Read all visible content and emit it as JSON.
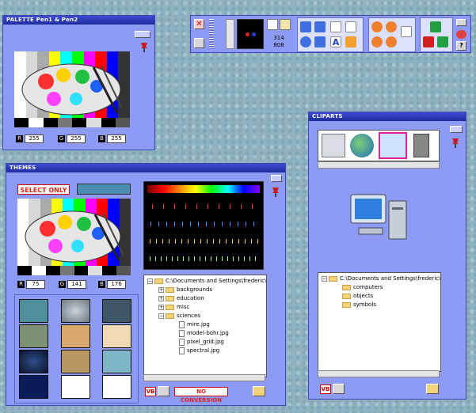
{
  "palette_window": {
    "title": "PALETTE Pen1 & Pen2",
    "rgb": [
      {
        "label": "R",
        "value": "255"
      },
      {
        "label": "G",
        "value": "255"
      },
      {
        "label": "B",
        "value": "255"
      }
    ]
  },
  "toolbar": {
    "counter_top": "314",
    "counter_bottom": "808"
  },
  "themes_window": {
    "title": "THEMES",
    "select_only_label": "SELECT ONLY",
    "rgb": [
      {
        "label": "R",
        "value": "75"
      },
      {
        "label": "G",
        "value": "141"
      },
      {
        "label": "B",
        "value": "176"
      }
    ],
    "tree": {
      "root": "C:\\Documents and Settings\\frederic\\",
      "folders": [
        "backgrounds",
        "education",
        "misc",
        "sciences"
      ],
      "files": [
        "mire.jpg",
        "model-bohr.jpg",
        "pixel_grid.jpg",
        "spectral.jpg"
      ]
    },
    "vb_label": "VB",
    "no_conversion_label": "NO CONVERSION"
  },
  "cliparts_window": {
    "title": "CLIPARTS",
    "tree": {
      "root": "C:\\Documents and Settings\\frederic\\",
      "folders": [
        "computers",
        "objects",
        "symbols"
      ]
    },
    "vb_label": "VB"
  },
  "colors": {
    "panel": "#8e9bf5",
    "titlebar": "#2232b8",
    "select_only_red": "#e0231b"
  }
}
